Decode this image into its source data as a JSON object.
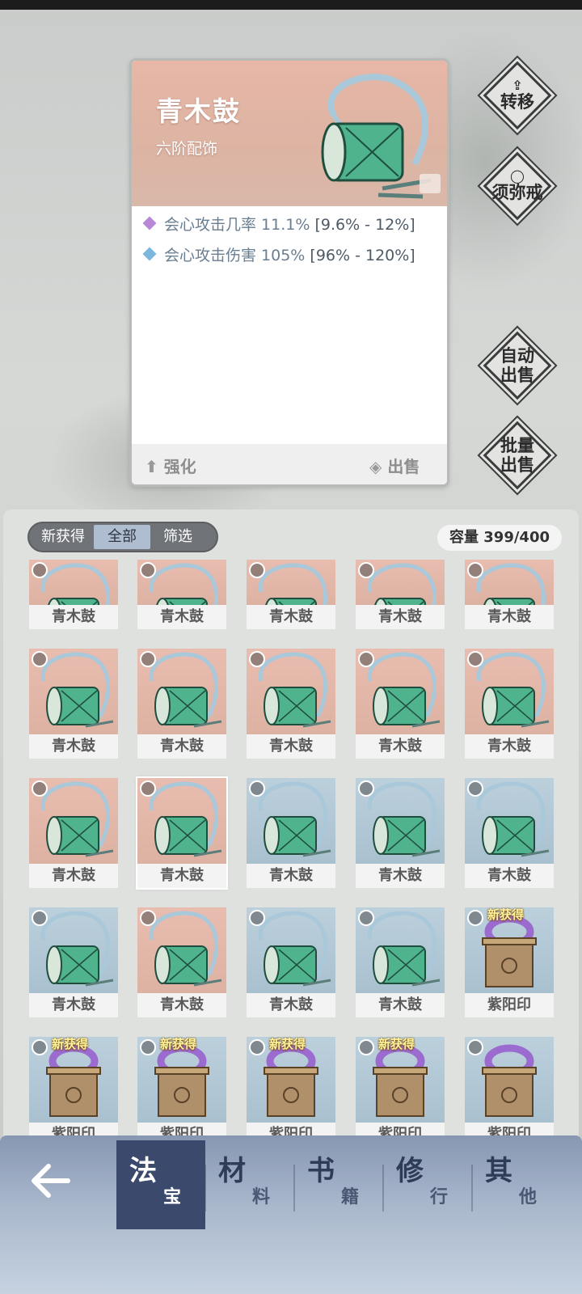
{
  "detail": {
    "name": "青木鼓",
    "grade": "六阶配饰",
    "stats": [
      {
        "label": "会心攻击几率 11.1%",
        "range": "[9.6% - 12%]",
        "color": "#b888d6"
      },
      {
        "label": "会心攻击伤害 105%",
        "range": "[96% - 120%]",
        "color": "#7ab6de"
      }
    ],
    "enhance_label": "强化",
    "sell_label": "出售"
  },
  "side_buttons": {
    "transfer": "转移",
    "ring": "须弥戒",
    "auto_sell": [
      "自动",
      "出售"
    ],
    "bulk_sell": [
      "批量",
      "出售"
    ]
  },
  "filters": {
    "tabs": [
      "新获得",
      "全部",
      "筛选"
    ],
    "active_index": 1
  },
  "capacity": "容量 399/400",
  "new_tag": "新获得",
  "items": [
    {
      "name": "青木鼓",
      "bg": "pink",
      "icon": "drum",
      "cut": true
    },
    {
      "name": "青木鼓",
      "bg": "pink",
      "icon": "drum",
      "cut": true
    },
    {
      "name": "青木鼓",
      "bg": "pink",
      "icon": "drum",
      "cut": true
    },
    {
      "name": "青木鼓",
      "bg": "pink",
      "icon": "drum",
      "cut": true
    },
    {
      "name": "青木鼓",
      "bg": "pink",
      "icon": "drum",
      "cut": true
    },
    {
      "name": "青木鼓",
      "bg": "pink",
      "icon": "drum"
    },
    {
      "name": "青木鼓",
      "bg": "pink",
      "icon": "drum"
    },
    {
      "name": "青木鼓",
      "bg": "pink",
      "icon": "drum"
    },
    {
      "name": "青木鼓",
      "bg": "pink",
      "icon": "drum"
    },
    {
      "name": "青木鼓",
      "bg": "pink",
      "icon": "drum"
    },
    {
      "name": "青木鼓",
      "bg": "pink",
      "icon": "drum"
    },
    {
      "name": "青木鼓",
      "bg": "pink",
      "icon": "drum",
      "selected": true
    },
    {
      "name": "青木鼓",
      "bg": "blue",
      "icon": "drum"
    },
    {
      "name": "青木鼓",
      "bg": "blue",
      "icon": "drum"
    },
    {
      "name": "青木鼓",
      "bg": "blue",
      "icon": "drum"
    },
    {
      "name": "青木鼓",
      "bg": "blue",
      "icon": "drum"
    },
    {
      "name": "青木鼓",
      "bg": "pink",
      "icon": "drum"
    },
    {
      "name": "青木鼓",
      "bg": "blue",
      "icon": "drum"
    },
    {
      "name": "青木鼓",
      "bg": "blue",
      "icon": "drum"
    },
    {
      "name": "紫阳印",
      "bg": "blue",
      "icon": "seal",
      "new": true
    },
    {
      "name": "紫阳印",
      "bg": "blue",
      "icon": "seal",
      "new": true
    },
    {
      "name": "紫阳印",
      "bg": "blue",
      "icon": "seal",
      "new": true
    },
    {
      "name": "紫阳印",
      "bg": "blue",
      "icon": "seal",
      "new": true
    },
    {
      "name": "紫阳印",
      "bg": "blue",
      "icon": "seal",
      "new": true
    },
    {
      "name": "紫阳印",
      "bg": "blue",
      "icon": "seal"
    }
  ],
  "nav": {
    "back_icon": "arrow-left-icon",
    "tabs": [
      {
        "big": "法",
        "small": "宝"
      },
      {
        "big": "材",
        "small": "料"
      },
      {
        "big": "书",
        "small": "籍"
      },
      {
        "big": "修",
        "small": "行"
      },
      {
        "big": "其",
        "small": "他"
      }
    ],
    "active_index": 0
  }
}
